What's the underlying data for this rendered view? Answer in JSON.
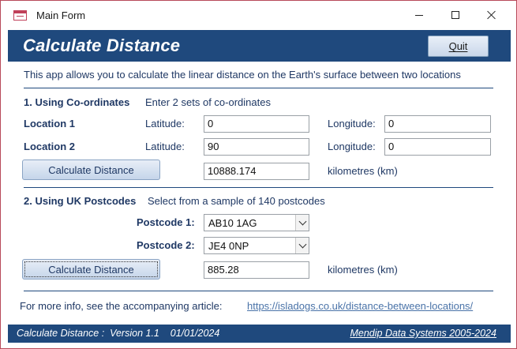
{
  "window": {
    "title": "Main Form",
    "icon": "form-icon",
    "controls": {
      "minimize": "minimize-icon",
      "maximize": "maximize-icon",
      "close": "close-icon"
    }
  },
  "header": {
    "title": "Calculate Distance",
    "quit_label": "Quit"
  },
  "intro": "This app allows you to calculate the linear distance on the Earth's surface between two locations",
  "section1": {
    "heading": "1. Using Co-ordinates",
    "hint": "Enter 2 sets of co-ordinates",
    "location1": {
      "label": "Location 1",
      "lat_label": "Latitude:",
      "lat_value": "0",
      "lon_label": "Longitude:",
      "lon_value": "0"
    },
    "location2": {
      "label": "Location 2",
      "lat_label": "Latitude:",
      "lat_value": "90",
      "lon_label": "Longitude:",
      "lon_value": "0"
    },
    "button_label": "Calculate Distance",
    "result": "10888.174",
    "unit": "kilometres (km)"
  },
  "section2": {
    "heading": "2. Using UK Postcodes",
    "hint": "Select from a sample of 140 postcodes",
    "postcode1": {
      "label": "Postcode 1:",
      "value": "AB10 1AG"
    },
    "postcode2": {
      "label": "Postcode 2:",
      "value": "JE4 0NP"
    },
    "button_label": "Calculate Distance",
    "result": "885.28",
    "unit": "kilometres (km)"
  },
  "more_info": {
    "text": "For more info, see the accompanying article:",
    "link": "https://isladogs.co.uk/distance-between-locations/"
  },
  "footer": {
    "left": "Calculate Distance :  Version 1.1    01/01/2024",
    "right": "Mendip Data Systems 2005-2024"
  },
  "colors": {
    "accent": "#1f497d",
    "border": "#b84a5a",
    "text": "#1f3864",
    "link": "#4a73a8"
  }
}
